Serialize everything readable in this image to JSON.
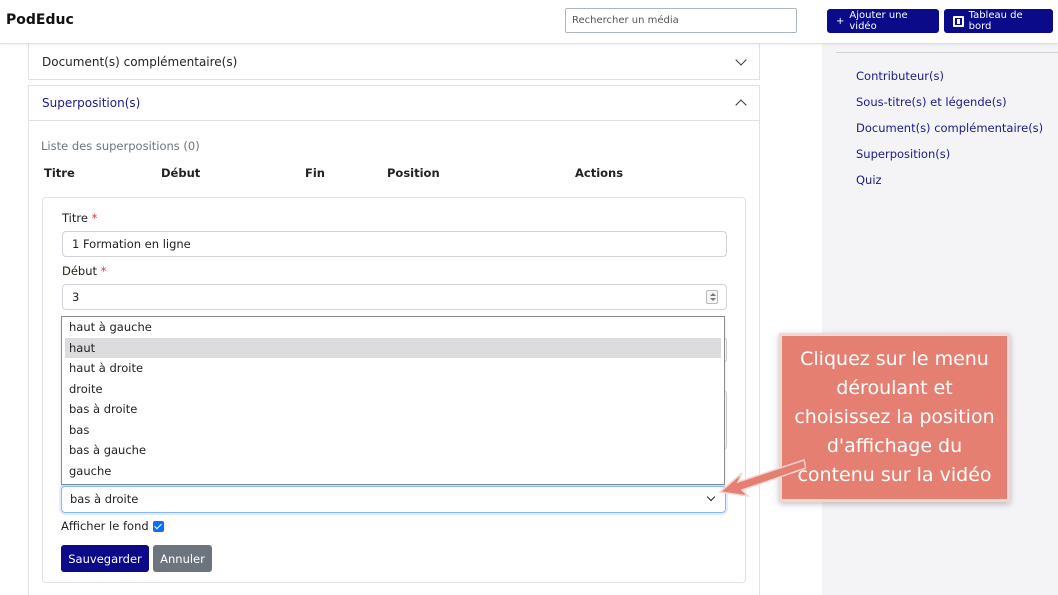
{
  "header": {
    "brand": "PodEduc",
    "search_placeholder": "Rechercher un média",
    "add_video_label": "Ajouter une vidéo",
    "dashboard_label": "Tableau de bord"
  },
  "accordion": {
    "docs_label": "Document(s) complémentaire(s)",
    "overlay_label": "Superposition(s)"
  },
  "overlay_list": {
    "title": "Liste des superpositions (0)",
    "columns": [
      "Titre",
      "Début",
      "Fin",
      "Position",
      "Actions"
    ]
  },
  "form": {
    "title_label": "Titre",
    "title_value": "1 Formation en ligne",
    "start_label": "Début",
    "start_value": "3",
    "required_mark": "*",
    "position_selected": "bas à droite",
    "position_options": [
      "haut à gauche",
      "haut",
      "haut à droite",
      "droite",
      "bas à droite",
      "bas",
      "bas à gauche",
      "gauche"
    ],
    "position_highlighted_index": 1,
    "show_bg_label": "Afficher le fond",
    "save_label": "Sauvegarder",
    "cancel_label": "Annuler"
  },
  "toc": [
    "Contributeur(s)",
    "Sous-titre(s) et légende(s)",
    "Document(s) complémentaire(s)",
    "Superposition(s)",
    "Quiz"
  ],
  "callout_text": "Cliquez sur le menu déroulant et choisissez la position d'affichage du contenu sur la vidéo",
  "colors": {
    "primary_dark": "#0b0b8a",
    "link": "#1a1a8a",
    "callout": "#e47f72",
    "required": "#dc3545"
  }
}
